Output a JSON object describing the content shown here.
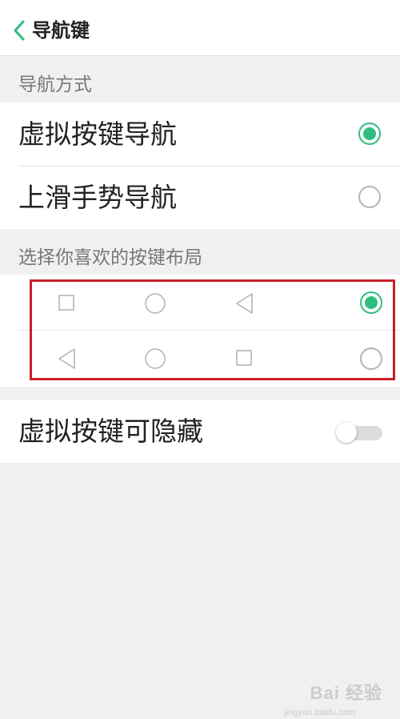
{
  "header": {
    "title": "导航键",
    "back_icon": "chevron-left-icon",
    "accent_color": "#2ebd7f"
  },
  "navigation_mode": {
    "section_label": "导航方式",
    "options": [
      {
        "label": "虚拟按键导航",
        "selected": true
      },
      {
        "label": "上滑手势导航",
        "selected": false
      }
    ]
  },
  "key_layout": {
    "section_label": "选择你喜欢的按键布局",
    "options": [
      {
        "icons": [
          "square-icon",
          "circle-icon",
          "triangle-left-icon"
        ],
        "selected": true
      },
      {
        "icons": [
          "triangle-left-icon",
          "circle-icon",
          "square-icon"
        ],
        "selected": false
      }
    ],
    "highlight_color": "#cc1f2a"
  },
  "hide_keys": {
    "label": "虚拟按键可隐藏",
    "enabled": false
  },
  "watermark": {
    "text": "Bai 经验",
    "subtext": "jingyan.baidu.com"
  }
}
